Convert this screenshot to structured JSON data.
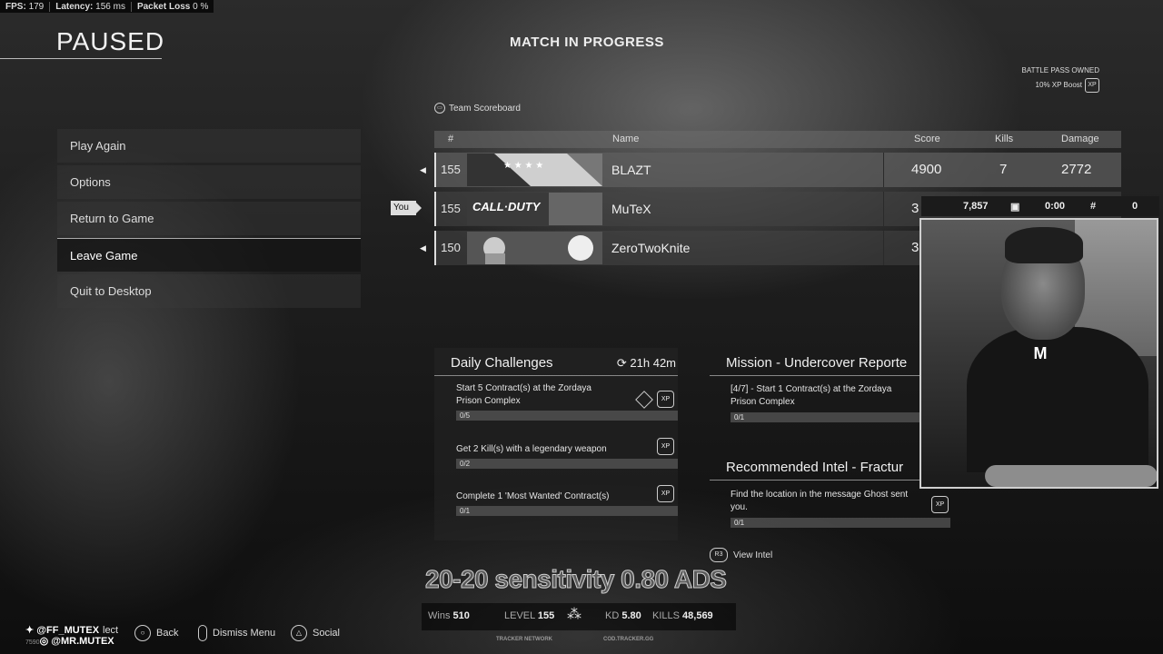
{
  "perf": {
    "fps_label": "FPS:",
    "fps_value": "179",
    "latency_label": "Latency:",
    "latency_value": "156 ms",
    "packet_label": "Packet Loss",
    "packet_value": "0 %"
  },
  "paused_title": "PAUSED",
  "menu": [
    {
      "label": "Play Again"
    },
    {
      "label": "Options"
    },
    {
      "label": "Return to Game"
    },
    {
      "label": "Leave Game"
    },
    {
      "label": "Quit to Desktop"
    }
  ],
  "match_title": "MATCH IN PROGRESS",
  "battle_pass": {
    "owned": "BATTLE PASS OWNED",
    "boost": "10% XP Boost",
    "icon": "xp-icon"
  },
  "team_scoreboard": "Team Scoreboard",
  "scoreboard": {
    "headers": {
      "rank": "#",
      "name": "Name",
      "score": "Score",
      "kills": "Kills",
      "damage": "Damage"
    },
    "you_label": "You",
    "rows": [
      {
        "rank": "155",
        "name": "BLAZT",
        "score": "4900",
        "kills": "7",
        "damage": "2772"
      },
      {
        "rank": "155",
        "name": "MuTeX",
        "score": "3"
      },
      {
        "rank": "150",
        "name": "ZeroTwoKnite",
        "score": "3"
      }
    ],
    "emblem_text": "CALL·DUTY"
  },
  "daily": {
    "title": "Daily Challenges",
    "timer": "21h 42m",
    "items": [
      {
        "text": "Start 5 Contract(s) at the Zordaya Prison Complex",
        "progress": "0/5"
      },
      {
        "text": "Get 2 Kill(s) with a legendary weapon",
        "progress": "0/2"
      },
      {
        "text": "Complete 1 'Most Wanted' Contract(s)",
        "progress": "0/1"
      }
    ],
    "xp_badge": "XP"
  },
  "mission": {
    "title": "Mission - Undercover Reporte",
    "text": "[4/7] - Start 1 Contract(s) at the Zordaya Prison Complex",
    "progress": "0/1"
  },
  "intel": {
    "title": "Recommended Intel - Fractur",
    "text": "Find the location in the message Ghost sent you.",
    "progress": "0/1",
    "view_button_icon": "R3",
    "view_label": "View Intel"
  },
  "cam_stats": {
    "value1": "7,857",
    "value2": "0:00",
    "value3": "0"
  },
  "cam_logo": "M",
  "sensitivity": "20-20 sensitivity 0.80 ADS",
  "stats": {
    "wins_label": "Wins",
    "wins": "510",
    "level_label": "LEVEL",
    "level": "155",
    "kd_label": "KD",
    "kd": "5.80",
    "kills_label": "KILLS",
    "kills": "48,569"
  },
  "tracker": {
    "left": "TRACKER NETWORK",
    "right": "COD.TRACKER.GG"
  },
  "footer": {
    "select_label": "lect",
    "back_label": "Back",
    "dismiss_label": "Dismiss Menu",
    "social_label": "Social"
  },
  "social": {
    "twitter": "@FF_MUTEX",
    "insta": "@MR.MUTEX",
    "prefix": "7590"
  }
}
